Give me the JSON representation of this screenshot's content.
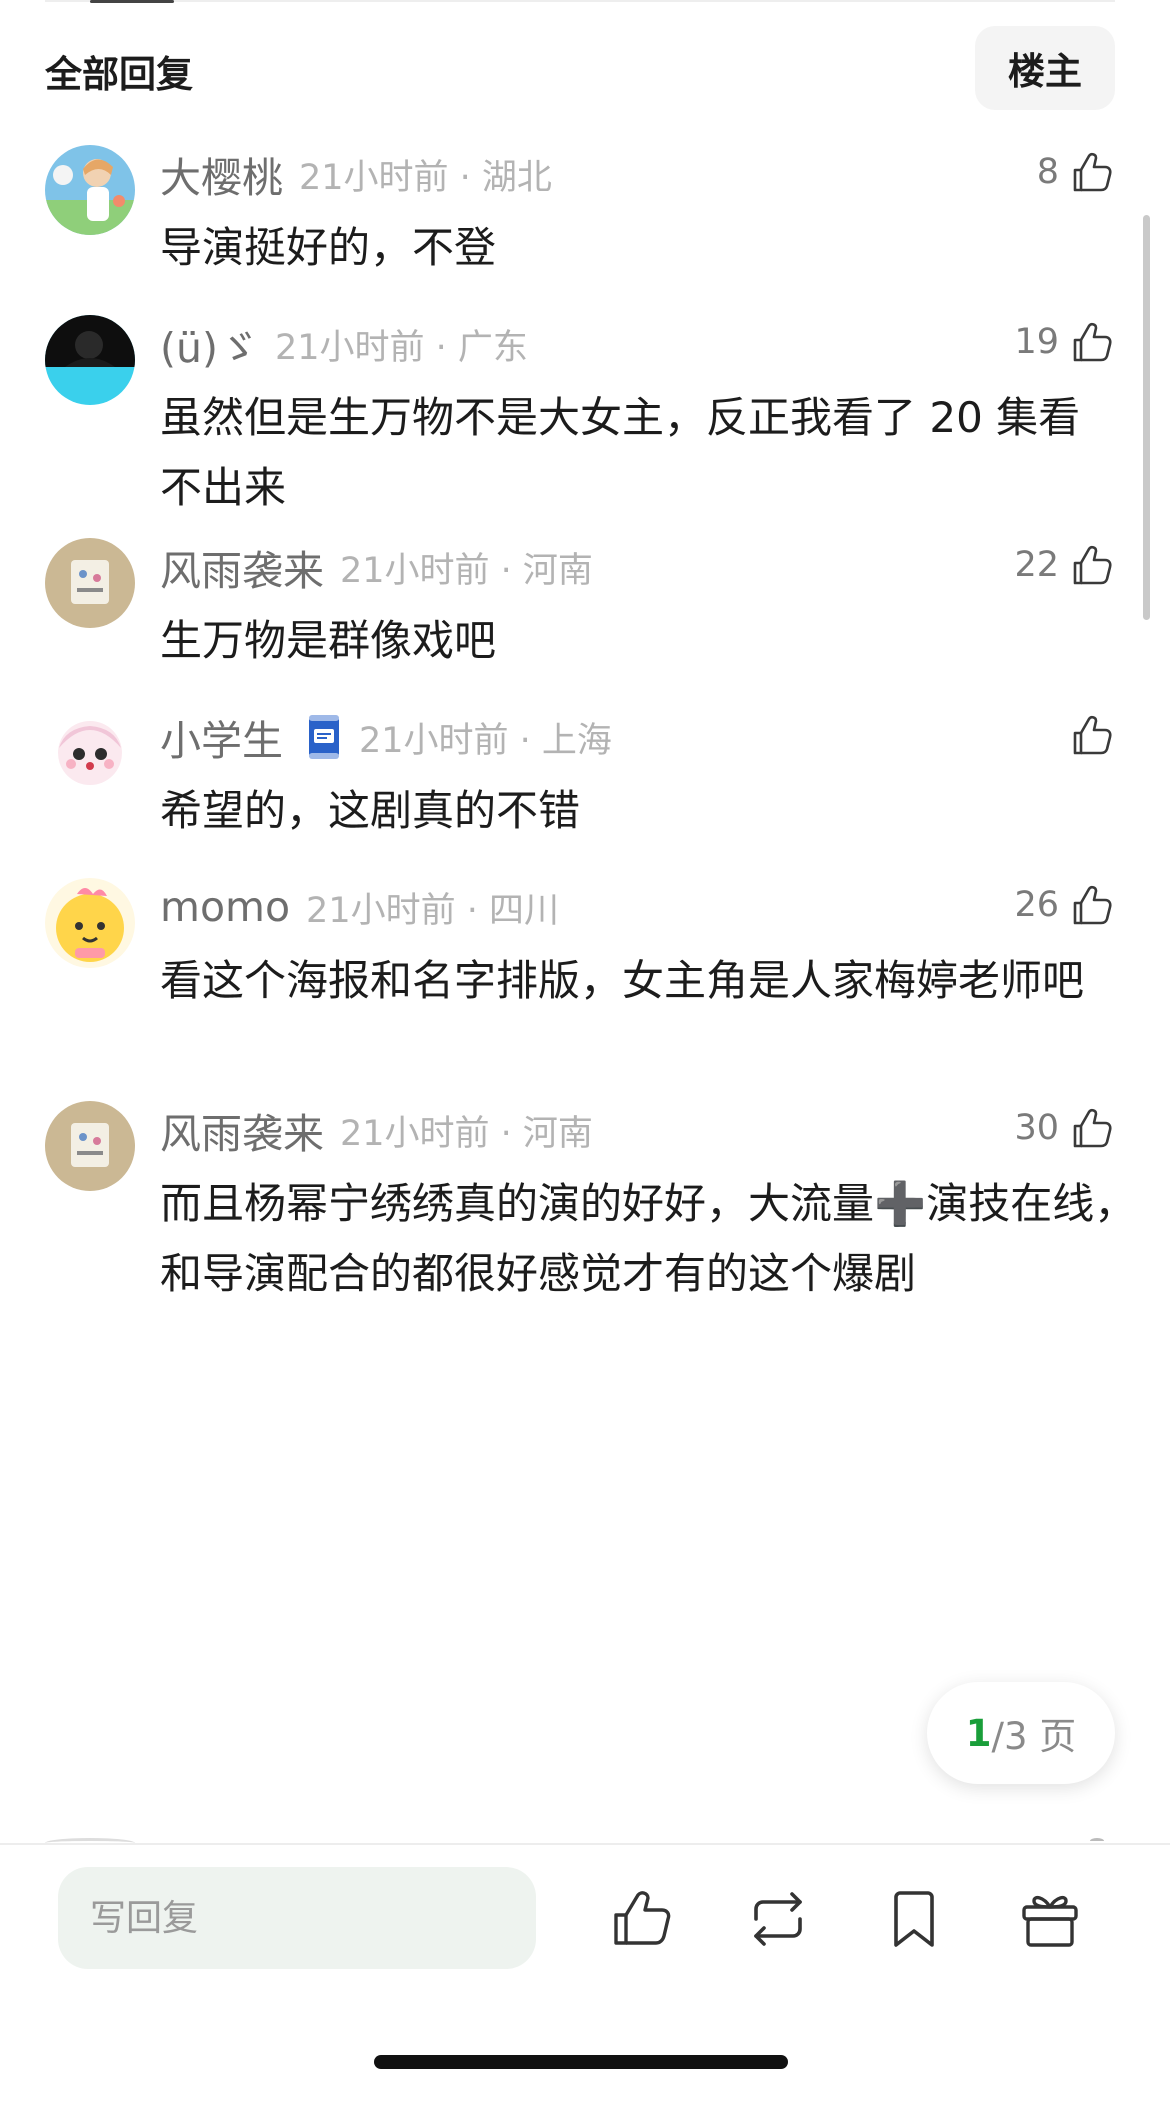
{
  "header": {
    "title": "全部回复",
    "owner_button": "楼主"
  },
  "comments": [
    {
      "user": "大樱桃",
      "time": "21小时前 · 湖北",
      "likes": "8",
      "text": "导演挺好的，不登",
      "avatar": "anime-boy-avatar"
    },
    {
      "user": "(ü)ゞ",
      "time": "21小时前 · 广东",
      "likes": "19",
      "text": "虽然但是生万物不是大女主，反正我看了 20 集看不出来",
      "avatar": "dark-cyan-avatar"
    },
    {
      "user": "风雨袭来",
      "time": "21小时前 · 河南",
      "likes": "22",
      "text": "生万物是群像戏吧",
      "avatar": "sticker-avatar"
    },
    {
      "user": "小学生",
      "time": "21小时前 · 上海",
      "likes": "",
      "text": "希望的，这剧真的不错",
      "avatar": "cute-girl-avatar",
      "badge": "can-badge"
    },
    {
      "user": "momo",
      "time": "21小时前 · 四川",
      "likes": "26",
      "text": "看这个海报和名字排版，女主角是人家梅婷老师吧",
      "avatar": "yellow-chick-avatar"
    },
    {
      "user": "风雨袭来",
      "time": "21小时前 · 河南",
      "likes": "30",
      "text": "而且杨幂宁绣绣真的演的好好，大流量➕演技在线，和导演配合的都很好感觉才有的这个爆剧",
      "avatar": "sticker-avatar"
    }
  ],
  "pagination": {
    "current": "1",
    "rest": "/3 页"
  },
  "bottom_bar": {
    "reply_placeholder": "写回复",
    "icons": [
      "like-icon",
      "repost-icon",
      "bookmark-icon",
      "gift-icon"
    ]
  },
  "colors": {
    "accent_green": "#1a9e3a",
    "meta_gray": "#b3b3b3",
    "username_gray": "#6e6e6e"
  }
}
